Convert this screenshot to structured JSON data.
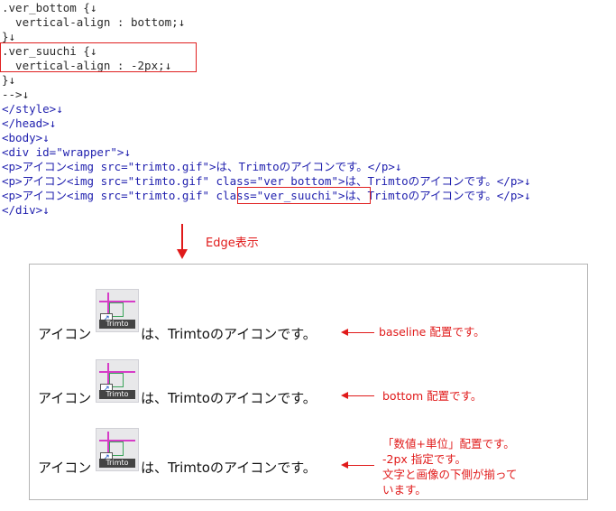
{
  "code": {
    "lines": [
      ".ver_bottom {↓",
      "  vertical-align : bottom;↓",
      "}↓",
      ".ver_suuchi {↓",
      "  vertical-align : -2px;↓",
      "}↓",
      "-->↓",
      "</style>↓",
      "</head>↓",
      "<body>↓",
      "<div id=\"wrapper\">↓",
      "<p>アイコン<img src=\"trimto.gif\">は、Trimtoのアイコンです。</p>↓",
      "<p>アイコン<img src=\"trimto.gif\" class=\"ver_bottom\">は、Trimtoのアイコンです。</p>↓",
      "<p>アイコン<img src=\"trimto.gif\" class=\"ver_suuchi\">は、Trimtoのアイコンです。</p>↓",
      "</div>↓"
    ]
  },
  "edge_label": "Edge表示",
  "render": {
    "prefix": "アイコン",
    "suffix": "は、Trimtoのアイコンです。",
    "icon_text": "Trimto"
  },
  "notes": {
    "baseline": "baseline 配置です。",
    "bottom": "bottom 配置です。",
    "suuchi": "「数値+単位」配置です。\n-2px 指定です。\n文字と画像の下側が揃って\nいます。"
  },
  "colors": {
    "accent": "#e01a1a",
    "tag": "#1f1fae",
    "frame": "#b5b5b5"
  }
}
